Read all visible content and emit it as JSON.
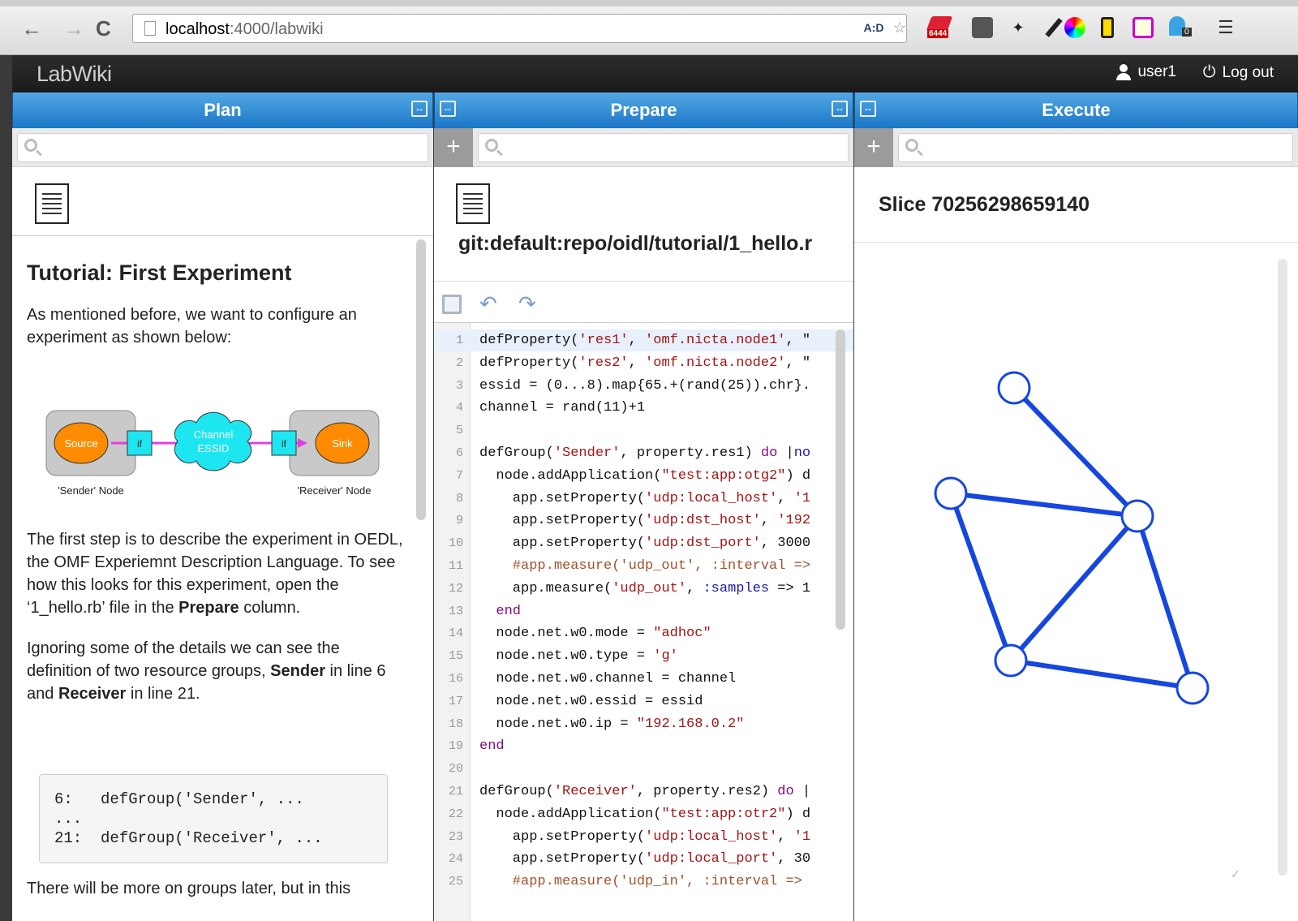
{
  "browser": {
    "url_host": "localhost",
    "url_path": ":4000/labwiki",
    "badge_count": "6444",
    "badge_zero": "0",
    "aid_label": "A:D"
  },
  "app": {
    "brand": "LabWiki",
    "user": "user1",
    "logout": "Log out"
  },
  "columns": {
    "plan": {
      "title": "Plan"
    },
    "prepare": {
      "title": "Prepare",
      "file": "git:default:repo/oidl/tutorial/1_hello.r"
    },
    "execute": {
      "title": "Execute",
      "slice": "Slice 70256298659140"
    }
  },
  "plan": {
    "heading": "Tutorial: First Experiment",
    "p1": "As mentioned before, we want to configure an experiment as shown below:",
    "diagram": {
      "source": "Source",
      "sink": "Sink",
      "if1": "if",
      "if2": "if",
      "channel1": "Channel",
      "channel2": "ESSID",
      "sender_node": "'Sender' Node",
      "receiver_node": "'Receiver' Node"
    },
    "p2a": "The first step is to describe the experiment in OEDL, the OMF Experiemnt Description Language. To see how this looks for this experiment, open the ‘1_hello.rb’ file in the ",
    "p2b": "Prepare",
    "p2c": " column.",
    "p3a": "Ignoring some of the details we can see the definition of two resource groups, ",
    "p3b": "Sender",
    "p3c": " in line 6 and ",
    "p3d": "Receiver",
    "p3e": " in line 21.",
    "code": "6:   defGroup('Sender', ...\n...\n21:  defGroup('Receiver', ...",
    "p4": "There will be more on groups later, but in this"
  },
  "code_lines": [
    {
      "n": "1",
      "segs": [
        [
          "",
          "defProperty("
        ],
        [
          "str",
          "'res1'"
        ],
        [
          "",
          ", "
        ],
        [
          "str",
          "'omf.nicta.node1'"
        ],
        [
          "",
          ", \""
        ]
      ]
    },
    {
      "n": "2",
      "segs": [
        [
          "",
          "defProperty("
        ],
        [
          "str",
          "'res2'"
        ],
        [
          "",
          ", "
        ],
        [
          "str",
          "'omf.nicta.node2'"
        ],
        [
          "",
          ", \""
        ]
      ]
    },
    {
      "n": "3",
      "segs": [
        [
          "",
          "essid = (0...8).map{65.+(rand(25)).chr}."
        ]
      ]
    },
    {
      "n": "4",
      "segs": [
        [
          "",
          "channel = rand(11)+1"
        ]
      ]
    },
    {
      "n": "5",
      "segs": [
        [
          "",
          ""
        ]
      ]
    },
    {
      "n": "6",
      "segs": [
        [
          "",
          "defGroup("
        ],
        [
          "str",
          "'Sender'"
        ],
        [
          "",
          ", property.res1) "
        ],
        [
          "kw",
          "do"
        ],
        [
          "",
          " |"
        ],
        [
          "sym",
          "no"
        ]
      ]
    },
    {
      "n": "7",
      "segs": [
        [
          "",
          "  node.addApplication("
        ],
        [
          "str",
          "\"test:app:otg2\""
        ],
        [
          "",
          ") d"
        ]
      ]
    },
    {
      "n": "8",
      "segs": [
        [
          "",
          "    app.setProperty("
        ],
        [
          "str",
          "'udp:local_host'"
        ],
        [
          "",
          ", "
        ],
        [
          "str",
          "'1"
        ]
      ]
    },
    {
      "n": "9",
      "segs": [
        [
          "",
          "    app.setProperty("
        ],
        [
          "str",
          "'udp:dst_host'"
        ],
        [
          "",
          ", "
        ],
        [
          "str",
          "'192"
        ]
      ]
    },
    {
      "n": "10",
      "segs": [
        [
          "",
          "    app.setProperty("
        ],
        [
          "str",
          "'udp:dst_port'"
        ],
        [
          "",
          ", 3000"
        ]
      ]
    },
    {
      "n": "11",
      "segs": [
        [
          "cm",
          "    #app.measure('udp_out', :interval =>"
        ]
      ]
    },
    {
      "n": "12",
      "segs": [
        [
          "",
          "    app.measure("
        ],
        [
          "str",
          "'udp_out'"
        ],
        [
          "",
          ", "
        ],
        [
          "sym",
          ":samples"
        ],
        [
          "",
          " => 1"
        ]
      ]
    },
    {
      "n": "13",
      "segs": [
        [
          "kw",
          "  end"
        ]
      ]
    },
    {
      "n": "14",
      "segs": [
        [
          "",
          "  node.net.w0.mode = "
        ],
        [
          "str",
          "\"adhoc\""
        ]
      ]
    },
    {
      "n": "15",
      "segs": [
        [
          "",
          "  node.net.w0.type = "
        ],
        [
          "str",
          "'g'"
        ]
      ]
    },
    {
      "n": "16",
      "segs": [
        [
          "",
          "  node.net.w0.channel = channel"
        ]
      ]
    },
    {
      "n": "17",
      "segs": [
        [
          "",
          "  node.net.w0.essid = essid"
        ]
      ]
    },
    {
      "n": "18",
      "segs": [
        [
          "",
          "  node.net.w0.ip = "
        ],
        [
          "str",
          "\"192.168.0.2\""
        ]
      ]
    },
    {
      "n": "19",
      "segs": [
        [
          "kw",
          "end"
        ]
      ]
    },
    {
      "n": "20",
      "segs": [
        [
          "",
          ""
        ]
      ]
    },
    {
      "n": "21",
      "segs": [
        [
          "",
          "defGroup("
        ],
        [
          "str",
          "'Receiver'"
        ],
        [
          "",
          ", property.res2) "
        ],
        [
          "kw",
          "do"
        ],
        [
          "",
          " |"
        ]
      ]
    },
    {
      "n": "22",
      "segs": [
        [
          "",
          "  node.addApplication("
        ],
        [
          "str",
          "\"test:app:otr2\""
        ],
        [
          "",
          ") d"
        ]
      ]
    },
    {
      "n": "23",
      "segs": [
        [
          "",
          "    app.setProperty("
        ],
        [
          "str",
          "'udp:local_host'"
        ],
        [
          "",
          ", "
        ],
        [
          "str",
          "'1"
        ]
      ]
    },
    {
      "n": "24",
      "segs": [
        [
          "",
          "    app.setProperty("
        ],
        [
          "str",
          "'udp:local_port'"
        ],
        [
          "",
          ", 30"
        ]
      ]
    },
    {
      "n": "25",
      "segs": [
        [
          "cm",
          "    #app.measure('udp_in', :interval =>"
        ]
      ]
    }
  ],
  "colors": {
    "header_blue": "#1b76c6",
    "graph_blue": "#1646e0",
    "node_orange": "#ff8c00",
    "channel_cyan": "#1ee6f0"
  }
}
